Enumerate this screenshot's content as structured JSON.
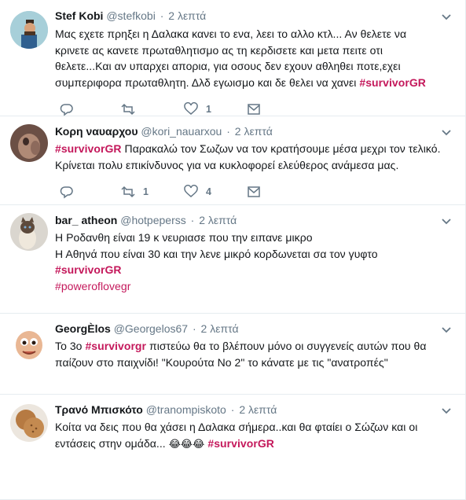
{
  "colors": {
    "hashtag": "#c4185b",
    "meta": "#657786",
    "text": "#14171a",
    "divider": "#e6ecf0"
  },
  "tweets": [
    {
      "fullname": "Stef Kobi",
      "handle": "@stefkobi",
      "dot": "·",
      "time": "2 λεπτά",
      "lines": [
        "Μας εχετε πρηξει η Δαλακα κανει το ενα, λεει το αλλο κτλ... Αν θελετε να",
        "κρινετε ας κανετε πρωταθλητισμο ας τη κερδισετε και μετα πειτε οτι",
        "θελετε...Και αν υπαρχει απορια, για οσους δεν εχουν αθληθει ποτε,εχει"
      ],
      "last_line_prefix": "συμπεριφορα πρωταθλητη. Δλδ εγωισμο και δε θελει να χανει ",
      "last_line_hashtag": "#survivorGR",
      "retweet_count": "",
      "like_count": "1"
    },
    {
      "fullname": "Κορη ναυαρχου",
      "handle": "@kori_nauarxou",
      "dot": "·",
      "time": "2 λεπτά",
      "first_line_hashtag": "#survivorGR",
      "first_line_rest": " Παρακαλώ τον Σωζων να τον κρατήσουμε μέσα μεχρι τον τελικό.",
      "lines": [
        "Κρίνεται πολυ επικίνδυνος για να κυκλοφορεί ελεύθερος ανάμεσα μας."
      ],
      "retweet_count": "1",
      "like_count": "4"
    },
    {
      "fullname": "bar_ atheon",
      "handle": "@hotpeperss",
      "dot": "·",
      "time": "2 λεπτά",
      "lines": [
        "Η Ροδανθη είναι  19  κ νευριασε που την ειπανε μικρο",
        "Η Αθηνά   που είναι   30  και την λενε μικρό   κορδωνεται σα τον γυφτο"
      ],
      "hashtag_line": "#survivorGR",
      "hashtag_line_2": "#poweroflovegr",
      "retweet_count": "",
      "like_count": ""
    },
    {
      "fullname": "GeorgÈlos",
      "handle": "@Georgelos67",
      "dot": "·",
      "time": "2 λεπτά",
      "first_line_prefix": "Το 3ο ",
      "first_line_hashtag": "#survivorgr",
      "first_line_rest": " πιστεύω θα το βλέπουν μόνο οι συγγενείς αυτών που θα",
      "lines": [
        "παίζουν στο παιχνίδι! \"Κουρούτα Νο 2\" το κάνατε με τις \"ανατροπές\""
      ],
      "retweet_count": "",
      "like_count": ""
    },
    {
      "fullname": "Τρανό Μπισκότο",
      "handle": "@tranompiskoto",
      "dot": "·",
      "time": "2 λεπτά",
      "lines": [
        "Κοίτα να δεις που θα χάσει η Δαλακα σήμερα..και θα φταίει ο Σώζων και οι"
      ],
      "last_line_prefix": "εντάσεις στην ομάδα... ",
      "emoji": "😂😂😂",
      "last_line_hashtag": "#survivorGR"
    }
  ]
}
